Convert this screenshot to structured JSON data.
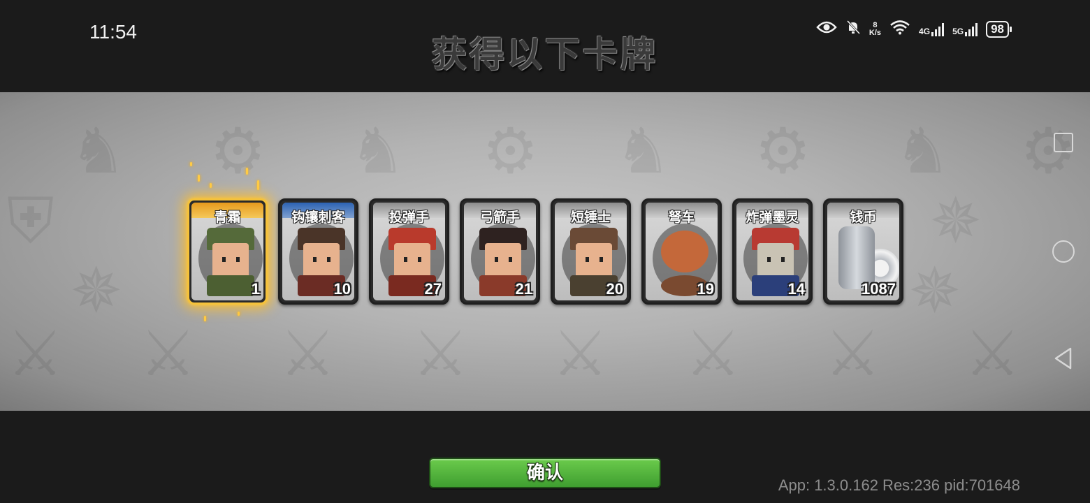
{
  "status_bar": {
    "time": "11:54",
    "net_speed_value": "8",
    "net_speed_unit": "K/s",
    "network1": "4G",
    "network2": "5G",
    "battery": "98"
  },
  "title": "获得以下卡牌",
  "cards": [
    {
      "name": "青霜",
      "count": "1",
      "rarity": "gold",
      "hat_color": "#556a3a",
      "body_color": "#4c5f32"
    },
    {
      "name": "钩镶刺客",
      "count": "10",
      "rarity": "blue",
      "hat_color": "#4a3428",
      "body_color": "#6b2c24"
    },
    {
      "name": "投弹手",
      "count": "27",
      "rarity": "gray",
      "hat_color": "#b93a2c",
      "body_color": "#7a2a20"
    },
    {
      "name": "弓箭手",
      "count": "21",
      "rarity": "gray",
      "hat_color": "#2e2220",
      "body_color": "#8a3a2a"
    },
    {
      "name": "短锤士",
      "count": "20",
      "rarity": "gray",
      "hat_color": "#6a4a36",
      "body_color": "#4a4030"
    },
    {
      "name": "弩车",
      "count": "19",
      "rarity": "gray",
      "hat_color": "#c4683a",
      "body_color": "#7a4a30"
    },
    {
      "name": "炸弹墨灵",
      "count": "14",
      "rarity": "gray",
      "hat_color": "#b83a32",
      "body_color": "#2b3f7a"
    },
    {
      "name": "钱币",
      "count": "1087",
      "rarity": "gray",
      "hat_color": "#b8bcc2",
      "body_color": "#8e939a"
    }
  ],
  "confirm_button": "确认",
  "version_info": "App: 1.3.0.162 Res:236 pid:701648",
  "colors": {
    "confirm_green": "#4fb03a",
    "gold_glow": "#f5c23b",
    "band_gray": "#b3b3b3"
  }
}
